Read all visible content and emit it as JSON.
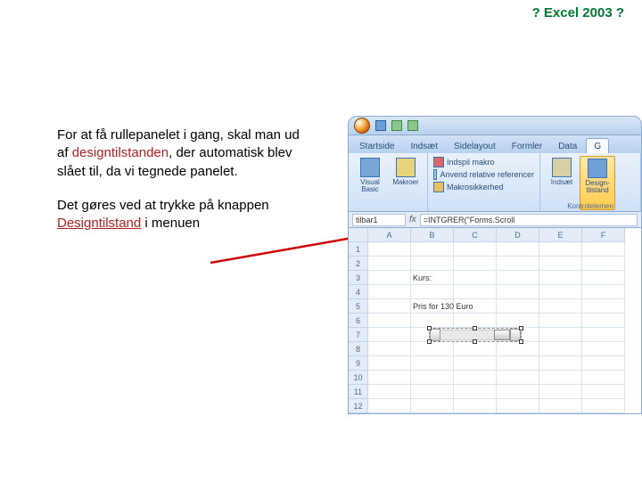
{
  "title": "? Excel 2003 ?",
  "para1_a": "For at få rullepanelet i gang, skal man ud af ",
  "para1_kw": "design­tilstanden",
  "para1_b": ", der automatisk blev slået til, da vi tegnede panelet.",
  "para2_a": "Det gøres ved at trykke på knappen ",
  "para2_kw": "Designtilstand",
  "para2_b": " i menuen",
  "ribbon": {
    "tabs": [
      "Startside",
      "Indsæt",
      "Sidelayout",
      "Formler",
      "Data",
      "G"
    ],
    "active_tab_index": 5,
    "group1_btn1": "Visual Basic",
    "group1_btn2": "Makroer",
    "group2_line1": "Indspil makro",
    "group2_line2": "Anvend relative referencer",
    "group2_line3": "Makrosikkerhed",
    "group3_btn1": "Indsæt",
    "group3_btn2": "Design­tilstand",
    "group3_caption": "Kontrolelemen"
  },
  "namebox": "tilbar1",
  "formula": "=INTGRER(\"Forms.Scroll",
  "columns": [
    "A",
    "B",
    "C",
    "D",
    "E",
    "F"
  ],
  "rows": [
    "1",
    "2",
    "3",
    "4",
    "5",
    "6",
    "7",
    "8",
    "9",
    "10",
    "11",
    "12"
  ],
  "cell_B3": "Kurs:",
  "cell_B5": "Pris for 130 Euro"
}
